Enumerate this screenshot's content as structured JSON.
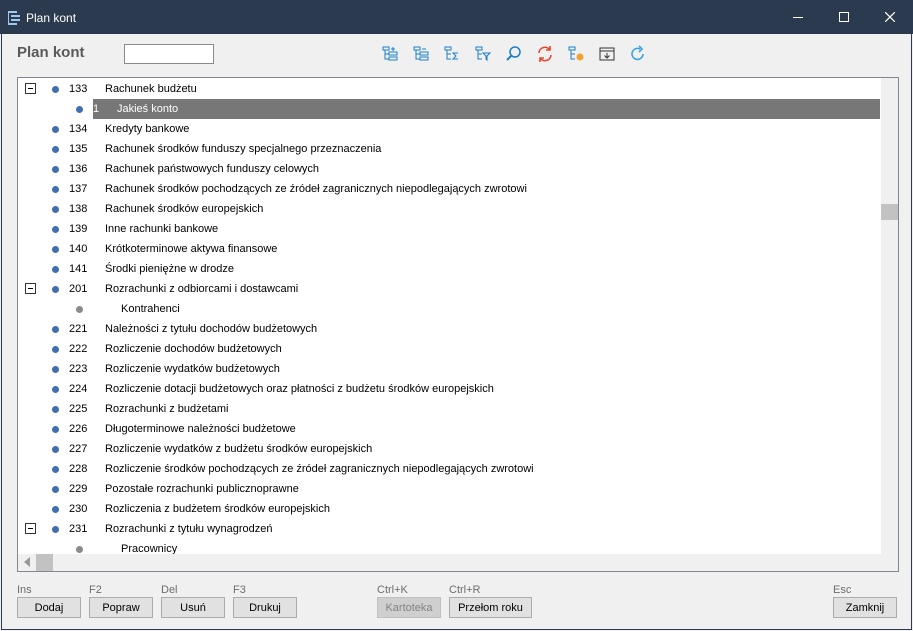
{
  "window": {
    "title": "Plan kont"
  },
  "header": {
    "title": "Plan kont",
    "filter_value": ""
  },
  "toolbar": {
    "tools": [
      "tree-expand-icon",
      "tree-collapse-icon",
      "tree-sum-icon",
      "tree-filter-icon",
      "search-icon",
      "refresh-swap-icon",
      "tree-settings-icon",
      "export-box-icon",
      "reload-icon"
    ]
  },
  "tree": {
    "rows": [
      {
        "expander": true,
        "dot": "blue",
        "level": 0,
        "code": "133",
        "name": "Rachunek budżetu"
      },
      {
        "expander": false,
        "dot": "blue",
        "level": 1,
        "code": "1",
        "name": "Jakieś konto",
        "selected": true
      },
      {
        "expander": false,
        "dot": "blue",
        "level": 0,
        "code": "134",
        "name": "Kredyty bankowe"
      },
      {
        "expander": false,
        "dot": "blue",
        "level": 0,
        "code": "135",
        "name": "Rachunek środków funduszy specjalnego przeznaczenia"
      },
      {
        "expander": false,
        "dot": "blue",
        "level": 0,
        "code": "136",
        "name": "Rachunek państwowych funduszy celowych"
      },
      {
        "expander": false,
        "dot": "blue",
        "level": 0,
        "code": "137",
        "name": "Rachunek środków pochodzących ze źródeł zagranicznych niepodlegających zwrotowi"
      },
      {
        "expander": false,
        "dot": "blue",
        "level": 0,
        "code": "138",
        "name": "Rachunek środków europejskich"
      },
      {
        "expander": false,
        "dot": "blue",
        "level": 0,
        "code": "139",
        "name": "Inne rachunki bankowe"
      },
      {
        "expander": false,
        "dot": "blue",
        "level": 0,
        "code": "140",
        "name": "Krótkoterminowe aktywa finansowe"
      },
      {
        "expander": false,
        "dot": "blue",
        "level": 0,
        "code": "141",
        "name": "Środki pieniężne w drodze"
      },
      {
        "expander": true,
        "dot": "blue",
        "level": 0,
        "code": "201",
        "name": "Rozrachunki z odbiorcami i dostawcami"
      },
      {
        "expander": false,
        "dot": "gray",
        "level": 1,
        "code": "",
        "name": "Kontrahenci"
      },
      {
        "expander": false,
        "dot": "blue",
        "level": 0,
        "code": "221",
        "name": "Należności z tytułu dochodów budżetowych"
      },
      {
        "expander": false,
        "dot": "blue",
        "level": 0,
        "code": "222",
        "name": "Rozliczenie dochodów budżetowych"
      },
      {
        "expander": false,
        "dot": "blue",
        "level": 0,
        "code": "223",
        "name": "Rozliczenie wydatków budżetowych"
      },
      {
        "expander": false,
        "dot": "blue",
        "level": 0,
        "code": "224",
        "name": "Rozliczenie dotacji budżetowych oraz płatności z budżetu środków europejskich"
      },
      {
        "expander": false,
        "dot": "blue",
        "level": 0,
        "code": "225",
        "name": "Rozrachunki z budżetami"
      },
      {
        "expander": false,
        "dot": "blue",
        "level": 0,
        "code": "226",
        "name": "Długoterminowe należności budżetowe"
      },
      {
        "expander": false,
        "dot": "blue",
        "level": 0,
        "code": "227",
        "name": "Rozliczenie wydatków z budżetu środków europejskich"
      },
      {
        "expander": false,
        "dot": "blue",
        "level": 0,
        "code": "228",
        "name": "Rozliczenie środków pochodzących ze źródeł zagranicznych niepodlegających zwrotowi"
      },
      {
        "expander": false,
        "dot": "blue",
        "level": 0,
        "code": "229",
        "name": "Pozostałe rozrachunki publicznoprawne"
      },
      {
        "expander": false,
        "dot": "blue",
        "level": 0,
        "code": "230",
        "name": "Rozliczenia z budżetem środków europejskich"
      },
      {
        "expander": true,
        "dot": "blue",
        "level": 0,
        "code": "231",
        "name": "Rozrachunki z tytułu wynagrodzeń"
      },
      {
        "expander": false,
        "dot": "gray",
        "level": 1,
        "code": "",
        "name": "Pracownicy"
      }
    ]
  },
  "footer": {
    "add": {
      "shortcut": "Ins",
      "label": "Dodaj"
    },
    "edit": {
      "shortcut": "F2",
      "label": "Popraw"
    },
    "delete": {
      "shortcut": "Del",
      "label": "Usuń"
    },
    "print": {
      "shortcut": "F3",
      "label": "Drukuj"
    },
    "card": {
      "shortcut": "Ctrl+K",
      "label": "Kartoteka"
    },
    "year_break": {
      "shortcut": "Ctrl+R",
      "label": "Przełom roku"
    },
    "close": {
      "shortcut": "Esc",
      "label": "Zamknij"
    }
  },
  "colors": {
    "titlebar": "#2b3a4e",
    "accent": "#1a7fc4",
    "selected_row": "#777777",
    "dot_blue": "#3f6fb0"
  }
}
